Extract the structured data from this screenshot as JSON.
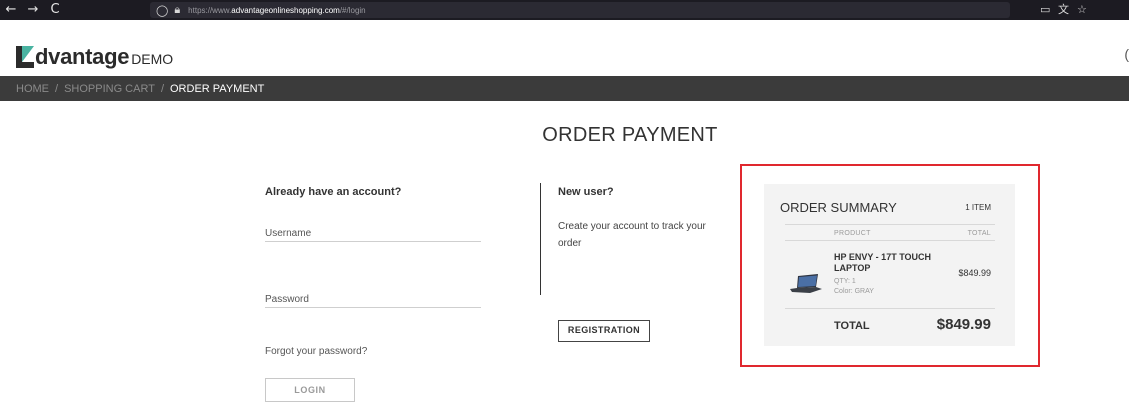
{
  "browser": {
    "back": "←",
    "forward": "→",
    "reload": "C",
    "url_prefix": "https://www.",
    "url_domain": "advantageonlineshopping.com",
    "url_path": "/#/login"
  },
  "header": {
    "logo_name": "dvantage",
    "logo_suffix": "DEMO",
    "edge_glyph": "("
  },
  "breadcrumb": {
    "items": [
      "HOME",
      "SHOPPING CART"
    ],
    "separator": "/",
    "active": "ORDER PAYMENT"
  },
  "page_title": "ORDER PAYMENT",
  "login": {
    "heading": "Already have an account?",
    "username_label": "Username",
    "password_label": "Password",
    "forgot": "Forgot your password?",
    "button": "LOGIN"
  },
  "new_user": {
    "heading": "New user?",
    "description": "Create your account to track your order",
    "button": "REGISTRATION"
  },
  "summary": {
    "title": "ORDER SUMMARY",
    "item_count": "1 ITEM",
    "col_product": "PRODUCT",
    "col_total": "TOTAL",
    "product_name": "HP ENVY - 17T TOUCH LAPTOP",
    "product_qty": "QTY: 1",
    "product_color": "Color: GRAY",
    "product_price": "$849.99",
    "total_label": "TOTAL",
    "total_value": "$849.99"
  },
  "colors": {
    "highlight": "#e0282e",
    "breadcrumb_bg": "#3b3b3b",
    "logo_accent": "#49b3a1"
  }
}
